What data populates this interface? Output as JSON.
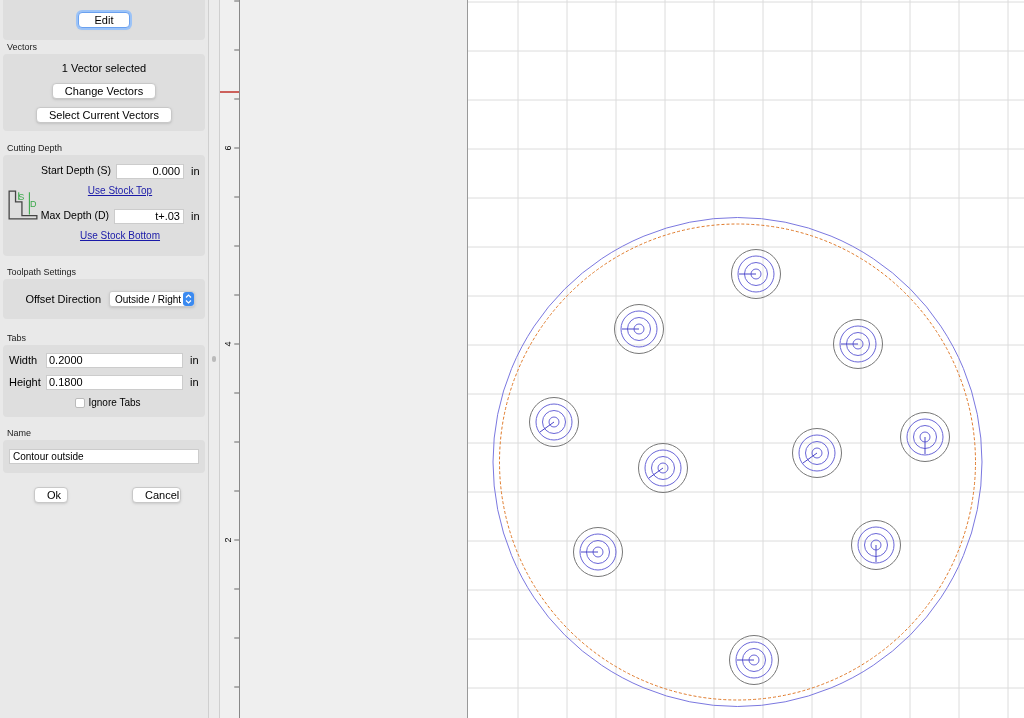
{
  "tool_section": {
    "edit_button": "Edit"
  },
  "vectors": {
    "title": "Vectors",
    "status": "1 Vector selected",
    "buttons": [
      "Change Vectors",
      "Select Current Vectors"
    ]
  },
  "cutting_depth": {
    "title": "Cutting Depth",
    "icon_labels": [
      "S",
      "D"
    ],
    "rows": [
      {
        "label": "Start Depth (S)",
        "value": "0.000",
        "unit": "in",
        "link": "Use Stock Top"
      },
      {
        "label": "Max Depth (D)",
        "value": "t+.03",
        "unit": "in",
        "link": "Use Stock Bottom"
      }
    ]
  },
  "toolpath_settings": {
    "title": "Toolpath Settings",
    "offset_label": "Offset Direction",
    "offset_value": "Outside / Right"
  },
  "tabs": {
    "title": "Tabs",
    "fields": [
      {
        "label": "Width",
        "value": "0.2000",
        "unit": "in"
      },
      {
        "label": "Height",
        "value": "0.1800",
        "unit": "in"
      }
    ],
    "ignore": {
      "label": "Ignore Tabs",
      "checked": false
    }
  },
  "name": {
    "title": "Name",
    "value": "Contour outside"
  },
  "actions": [
    "Ok",
    "Cancel"
  ],
  "ruler": {
    "labels": [
      "6",
      "4",
      "2"
    ]
  }
}
